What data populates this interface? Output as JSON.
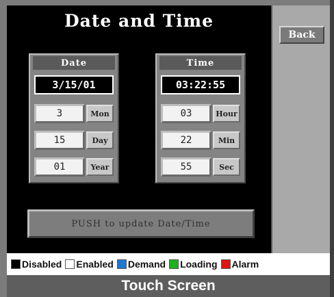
{
  "screen": {
    "title": "Date and Time",
    "back_label": "Back"
  },
  "date_group": {
    "header": "Date",
    "display": "3/15/01",
    "fields": [
      {
        "value": "3",
        "unit": "Mon"
      },
      {
        "value": "15",
        "unit": "Day"
      },
      {
        "value": "01",
        "unit": "Year"
      }
    ]
  },
  "time_group": {
    "header": "Time",
    "display": "03:22:55",
    "fields": [
      {
        "value": "03",
        "unit": "Hour"
      },
      {
        "value": "22",
        "unit": "Min"
      },
      {
        "value": "55",
        "unit": "Sec"
      }
    ]
  },
  "push_button": {
    "label": "PUSH to update Date/Time"
  },
  "legend": {
    "items": [
      {
        "label": "Disabled",
        "color": "#000000"
      },
      {
        "label": "Enabled",
        "color": "#ffffff"
      },
      {
        "label": "Demand",
        "color": "#1e78d2"
      },
      {
        "label": "Loading",
        "color": "#1fb11f"
      },
      {
        "label": "Alarm",
        "color": "#e01515"
      }
    ]
  },
  "footer": {
    "label": "Touch Screen"
  }
}
